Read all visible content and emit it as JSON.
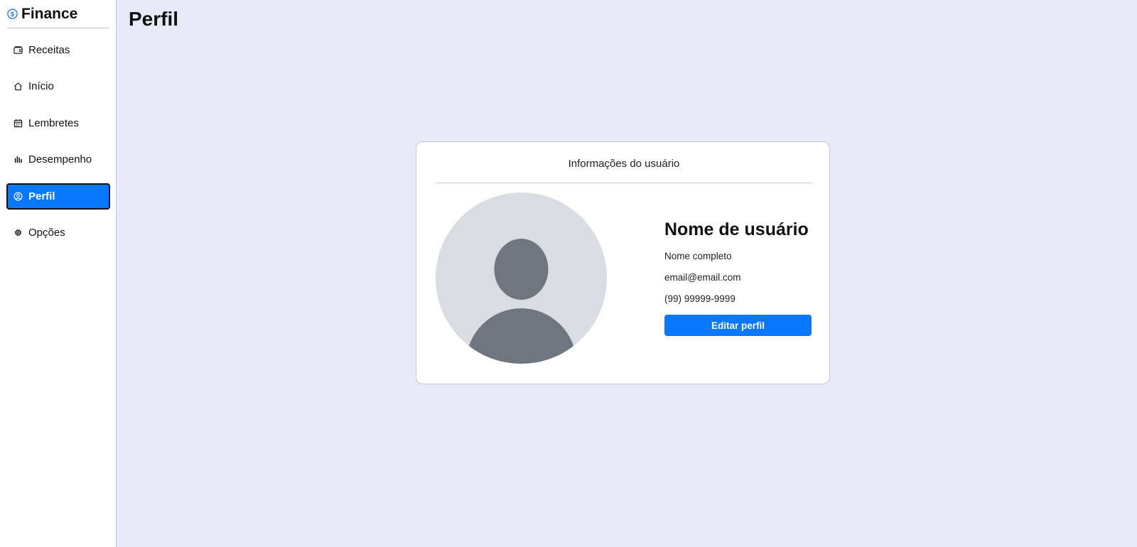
{
  "app": {
    "title": "Finance",
    "icon": "dollar-circle-icon",
    "accent_color": "#0a77ff"
  },
  "sidebar": {
    "items": [
      {
        "label": "Receitas",
        "icon": "wallet-icon",
        "active": false
      },
      {
        "label": "Início",
        "icon": "home-icon",
        "active": false
      },
      {
        "label": "Lembretes",
        "icon": "calendar-icon",
        "active": false
      },
      {
        "label": "Desempenho",
        "icon": "bar-chart-icon",
        "active": false
      },
      {
        "label": "Perfil",
        "icon": "user-circle-icon",
        "active": true
      },
      {
        "label": "Opções",
        "icon": "gear-icon",
        "active": false
      }
    ]
  },
  "page": {
    "title": "Perfil"
  },
  "profile_card": {
    "header": "Informações do usuário",
    "username": "Nome de usuário",
    "full_name": "Nome completo",
    "email": "email@email.com",
    "phone": "(99) 99999-9999",
    "edit_button_label": "Editar perfil",
    "avatar_icon": "default-avatar-icon"
  }
}
